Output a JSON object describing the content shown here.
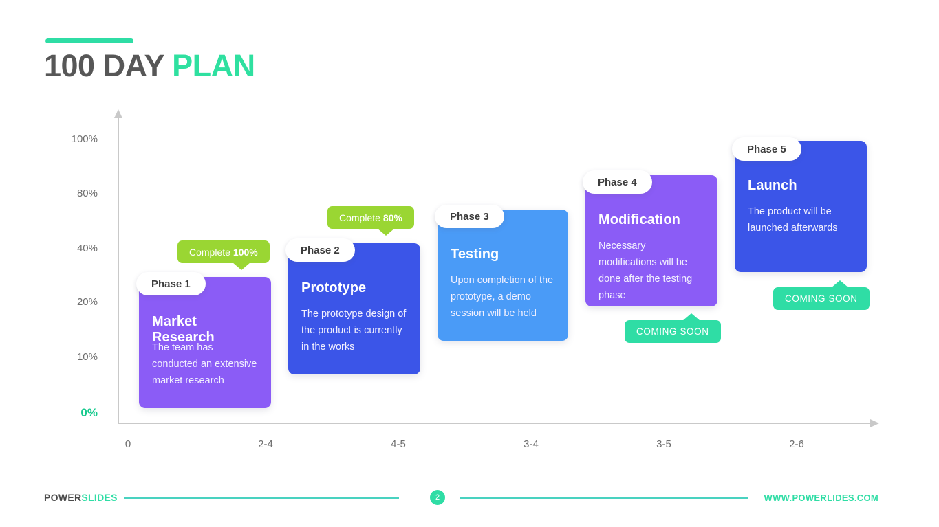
{
  "title": {
    "main": "100 DAY ",
    "accent": "PLAN"
  },
  "chart_data": {
    "type": "bar",
    "title": "100 DAY PLAN",
    "xlabel": "",
    "ylabel": "",
    "grid": false,
    "legend": "none",
    "y_ticks": [
      "100%",
      "80%",
      "40%",
      "20%",
      "10%",
      "0%"
    ],
    "x_ticks": [
      "0",
      "2-4",
      "4-5",
      "3-4",
      "3-5",
      "2-6"
    ],
    "categories": [
      "Phase 1",
      "Phase 2",
      "Phase 3",
      "Phase 4",
      "Phase 5"
    ],
    "values": [
      30,
      48,
      62,
      78,
      92
    ],
    "series": [
      {
        "name": "Completion",
        "values": [
          100,
          80,
          null,
          null,
          null
        ]
      }
    ]
  },
  "phases": [
    {
      "pill": "Phase 1",
      "title": "Market Research",
      "desc": "The team has conducted an extensive market research",
      "color": "#8b5cf6",
      "badge": {
        "kind": "complete",
        "label": "Complete ",
        "value": "100%"
      }
    },
    {
      "pill": "Phase 2",
      "title": "Prototype",
      "desc": "The prototype design of the product is currently in the works",
      "color": "#3b55e8",
      "badge": {
        "kind": "complete",
        "label": "Complete ",
        "value": "80%"
      }
    },
    {
      "pill": "Phase 3",
      "title": "Testing",
      "desc": "Upon completion of the prototype, a demo session will be held",
      "color": "#4a9bf7",
      "badge": null
    },
    {
      "pill": "Phase 4",
      "title": "Modification",
      "desc": "Necessary modifications will be done after the testing phase",
      "color": "#8b5cf6",
      "badge": {
        "kind": "soon",
        "label": "COMING SOON",
        "value": ""
      }
    },
    {
      "pill": "Phase 5",
      "title": "Launch",
      "desc": "The product will be launched afterwards",
      "color": "#3b55e8",
      "badge": {
        "kind": "soon",
        "label": "COMING SOON",
        "value": ""
      }
    }
  ],
  "footer": {
    "brand_main": "POWER",
    "brand_accent": "SLIDES",
    "page_number": "2",
    "url": "WWW.POWERLIDES.COM"
  }
}
